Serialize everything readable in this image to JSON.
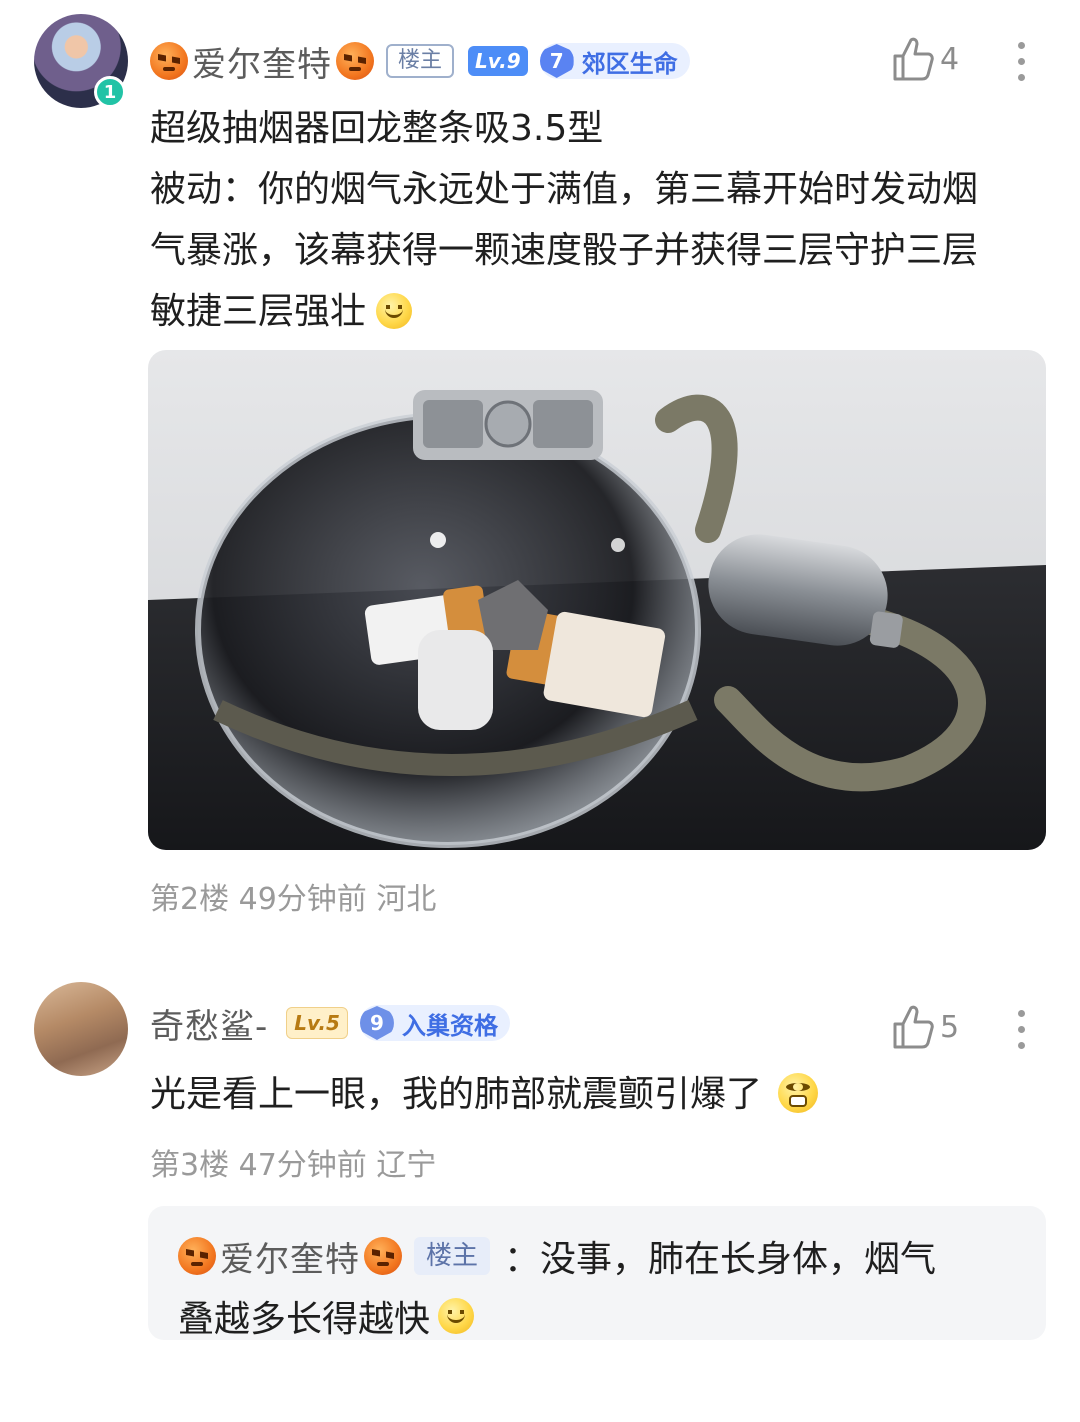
{
  "comments": [
    {
      "username": "爱尔奎特",
      "owner_tag": "楼主",
      "level": "Lv.9",
      "title_num": "7",
      "title_text": "郊区生命",
      "avatar_badge": "1",
      "likes": "4",
      "text_lines": [
        "超级抽烟器回龙整条吸3.5型",
        "被动：你的烟气永远处于满值，第三幕开始时发动烟",
        "气暴涨，该幕获得一颗速度骰子并获得三层守护三层",
        "敏捷三层强壮"
      ],
      "meta": "第2楼  49分钟前  河北"
    },
    {
      "username": "奇愁鲨-",
      "level": "Lv.5",
      "title_num": "9",
      "title_text": "入巢资格",
      "likes": "5",
      "text": "光是看上一眼，我的肺部就震颤引爆了",
      "meta": "第3楼  47分钟前  辽宁"
    }
  ],
  "reply": {
    "username": "爱尔奎特",
    "owner_tag": "楼主",
    "line1": "：没事，肺在长身体，烟气",
    "line2": "叠越多长得越快"
  }
}
